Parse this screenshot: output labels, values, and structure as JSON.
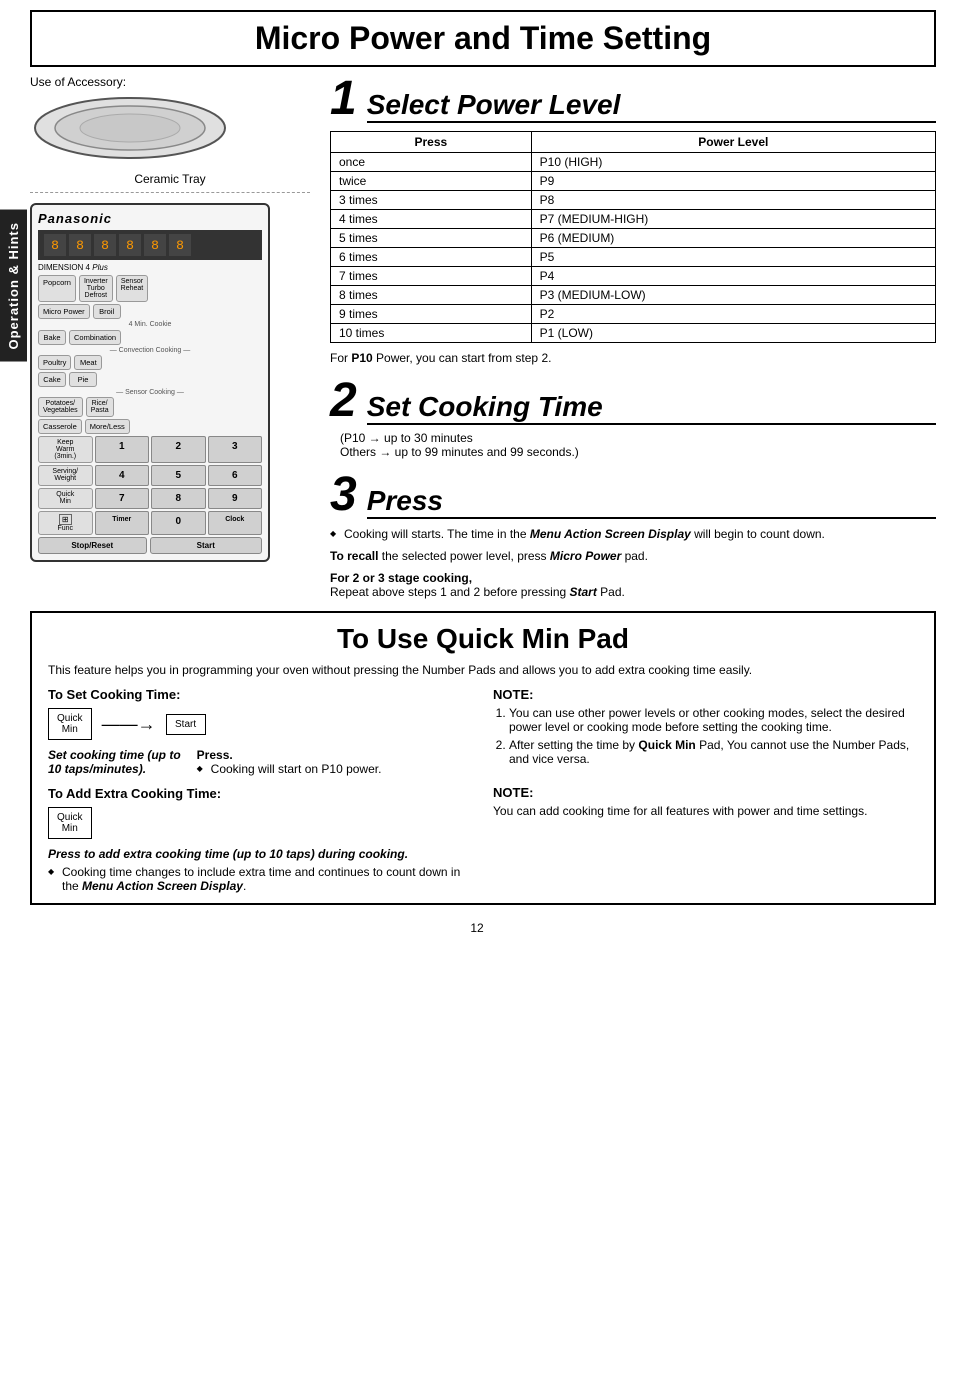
{
  "page": {
    "title": "Micro Power and Time Setting",
    "side_tab": "Operation & Hints",
    "page_number": "12"
  },
  "accessory": {
    "label": "Use of Accessory:",
    "tray_label": "Ceramic Tray"
  },
  "microwave": {
    "brand": "Panasonic",
    "dim4": "DIMENSION 4",
    "buttons": {
      "popcorn": "Popcorn",
      "inverter_turbo_defrost": "Inverter Turbo Defrost",
      "sensor_reheat": "Sensor Reheat",
      "micro_power": "Micro Power",
      "broil": "Broil",
      "4min_cookie": "4 Min. Cookie",
      "bake": "Bake",
      "combination": "Combination",
      "convection_cooking": "Convection Cooking",
      "poultry": "Poultry",
      "meat": "Meat",
      "cake": "Cake",
      "pie": "Pie",
      "sensor_cooking": "Sensor Cooking",
      "potatoes_vegetables": "Potatoes/ Vegetables",
      "rice_pasta": "Rice/ Pasta",
      "casserole": "Casserole",
      "more_less": "More/Less",
      "keep_warm": "Keep Warm (3 min.)",
      "serving_weight": "Serving/ Weight",
      "quick_min": "Quick Min",
      "timer": "Timer",
      "clock": "Clock",
      "function": "Function",
      "stop_reset": "Stop/Reset",
      "start": "Start"
    },
    "num_keys": [
      "1",
      "2",
      "3",
      "4",
      "5",
      "6",
      "7",
      "8",
      "9",
      "0"
    ]
  },
  "step1": {
    "number": "1",
    "title": "Select Power Level",
    "table_headers": [
      "Press",
      "Power Level"
    ],
    "table_rows": [
      [
        "once",
        "P10 (HIGH)"
      ],
      [
        "twice",
        "P9"
      ],
      [
        "3 times",
        "P8"
      ],
      [
        "4 times",
        "P7 (MEDIUM-HIGH)"
      ],
      [
        "5 times",
        "P6 (MEDIUM)"
      ],
      [
        "6 times",
        "P5"
      ],
      [
        "7 times",
        "P4"
      ],
      [
        "8 times",
        "P3 (MEDIUM-LOW)"
      ],
      [
        "9 times",
        "P2"
      ],
      [
        "10 times",
        "P1 (LOW)"
      ]
    ],
    "p10_note": "For P10 Power, you can start from step 2."
  },
  "step2": {
    "number": "2",
    "title": "Set Cooking Time",
    "desc_line1": "(P10 → up to 30 minutes",
    "desc_line2": "Others → up to 99 minutes and 99 seconds.)"
  },
  "step3": {
    "number": "3",
    "title": "Press",
    "bullet1": "Cooking will starts. The time in the Menu Action Screen Display will begin to count down.",
    "recall_label": "To recall",
    "recall_text": " the selected power level, press Micro Power pad.",
    "stage_heading": "For 2 or 3 stage cooking,",
    "stage_text": "Repeat above steps 1 and 2 before pressing Start Pad."
  },
  "quick_min": {
    "title": "To Use Quick Min Pad",
    "intro": "This feature helps you in programming your oven without pressing the Number Pads and allows you to add extra cooking time easily.",
    "set_title": "To Set Cooking Time:",
    "btn_quick_min": "Quick Min",
    "btn_start": "Start",
    "caption_left": "Set cooking time (up to 10 taps/minutes).",
    "caption_right_label": "Press.",
    "caption_right_bullet": "Cooking will start on P10 power.",
    "add_title": "To Add Extra Cooking Time:",
    "btn_quick_min2": "Quick Min",
    "press_caption": "Press to add extra cooking time (up to 10 taps) during cooking.",
    "press_bullet": "Cooking time changes to include extra time and continues to count down in the Menu Action Screen Display.",
    "note1_title": "NOTE:",
    "note1_items": [
      "You can use other power levels or other cooking modes, select the desired power level or cooking mode before setting the cooking time.",
      "After setting the time by Quick Min Pad, You cannot use the Number Pads, and vice versa."
    ],
    "note2_title": "NOTE:",
    "note2_text": "You can add cooking time for all features with power and time settings."
  }
}
